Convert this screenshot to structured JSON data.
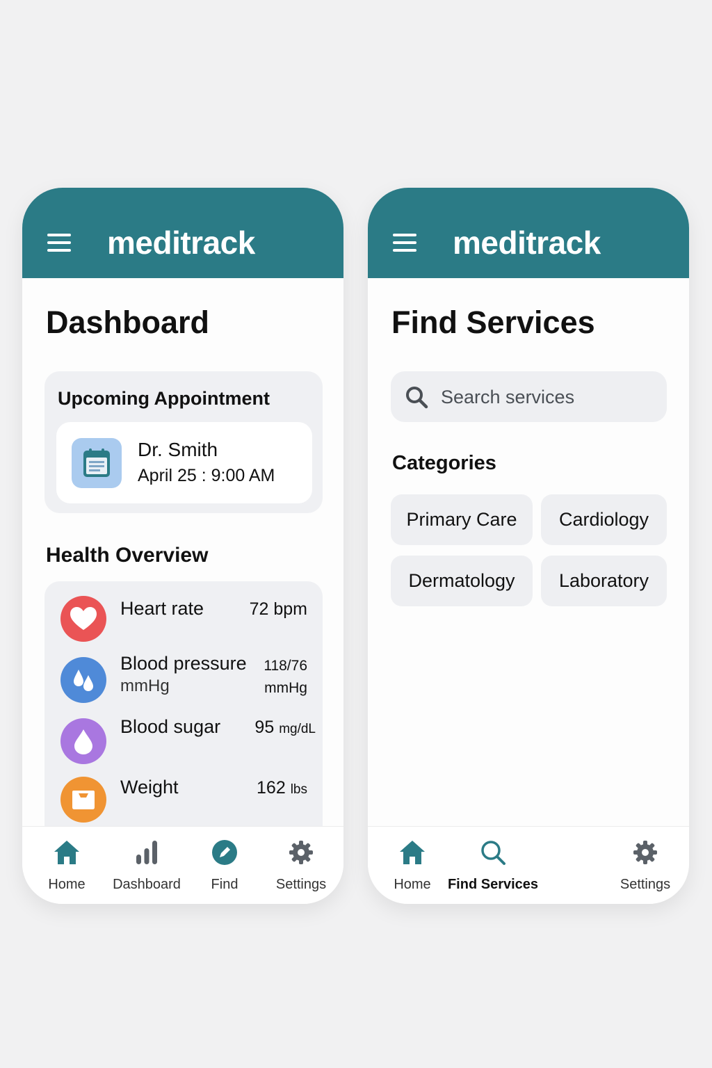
{
  "colors": {
    "header": "#2b7b86",
    "accent": "#2b7b86",
    "heart": "#ea5455",
    "pressure": "#4f8ad8",
    "sugar": "#a977e0",
    "weight": "#f09433",
    "calendar_bg": "#aacbef"
  },
  "dashboard_screen": {
    "header": {
      "brand": "meditrack",
      "menu_icon": "hamburger-icon"
    },
    "title": "Dashboard",
    "appointment": {
      "heading": "Upcoming Appointment",
      "icon": "calendar-icon",
      "doctor": "Dr. Smith",
      "datetime": "April 25 : 9:00 AM"
    },
    "health_overview": {
      "title": "Health Overview",
      "metrics": [
        {
          "icon": "heart-icon",
          "label": "Heart rate",
          "value": "72",
          "unit": "bpm"
        },
        {
          "icon": "drops-icon",
          "label": "Blood pressure",
          "sublabel": "mmHg",
          "value": "118/76",
          "unit": "mmHg"
        },
        {
          "icon": "drop-icon",
          "label": "Blood sugar",
          "value": "95",
          "unit": "mg/dL"
        },
        {
          "icon": "scale-icon",
          "label": "Weight",
          "value": "162",
          "unit": "lbs"
        }
      ]
    },
    "nav": [
      {
        "icon": "home-icon",
        "label": "Home"
      },
      {
        "icon": "bar-chart-icon",
        "label": "Dashboard"
      },
      {
        "icon": "pen-icon",
        "label": "Find"
      },
      {
        "icon": "gear-icon",
        "label": "Settings"
      }
    ]
  },
  "find_screen": {
    "header": {
      "brand": "meditrack",
      "menu_icon": "hamburger-icon"
    },
    "title": "Find Services",
    "search": {
      "placeholder": "Search services",
      "icon": "search-icon"
    },
    "categories_title": "Categories",
    "categories": [
      "Primary Care",
      "Cardiology",
      "Dermatology",
      "Laboratory"
    ],
    "nav": [
      {
        "icon": "home-icon",
        "label": "Home"
      },
      {
        "icon": "search-icon",
        "label": "Find Services",
        "active": true
      },
      {
        "icon": "gear-icon",
        "label": "Settings"
      }
    ]
  }
}
